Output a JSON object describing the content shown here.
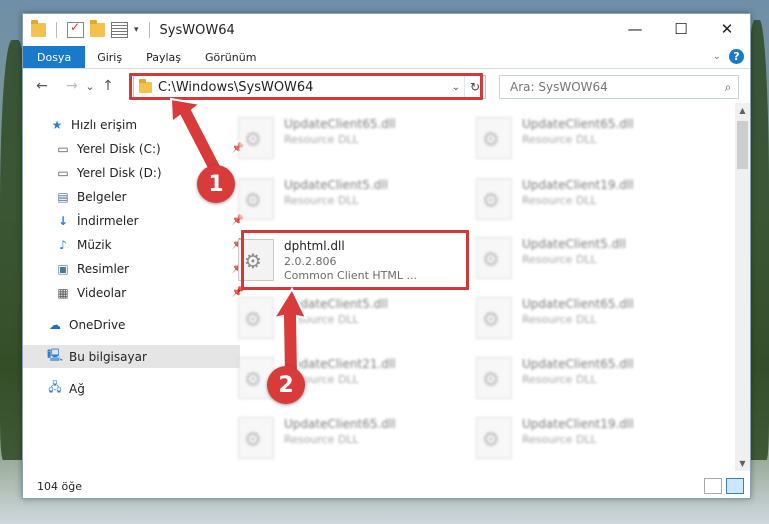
{
  "window": {
    "title": "SysWOW64",
    "buttons": {
      "minimize": "—",
      "maximize": "☐",
      "close": "✕"
    }
  },
  "ribbon": {
    "tabs": [
      "Dosya",
      "Giriş",
      "Paylaş",
      "Görünüm"
    ],
    "active": "Dosya",
    "help": "?"
  },
  "nav": {
    "back": "←",
    "forward": "→",
    "recent": "⌄",
    "up": "↑",
    "address": "C:\\Windows\\SysWOW64",
    "search_placeholder": "Ara: SysWOW64"
  },
  "sidebar": {
    "items": [
      {
        "label": "Hızlı erişim",
        "icon": "star-icon",
        "pinned": false
      },
      {
        "label": "Yerel Disk (C:)",
        "icon": "drive-icon",
        "pinned": true
      },
      {
        "label": "Yerel Disk (D:)",
        "icon": "drive-icon",
        "pinned": false
      },
      {
        "label": "Belgeler",
        "icon": "document-icon",
        "pinned": false
      },
      {
        "label": "İndirmeler",
        "icon": "download-icon",
        "pinned": true
      },
      {
        "label": "Müzik",
        "icon": "music-icon",
        "pinned": true
      },
      {
        "label": "Resimler",
        "icon": "pictures-icon",
        "pinned": true
      },
      {
        "label": "Videolar",
        "icon": "video-icon",
        "pinned": true
      },
      {
        "label": "OneDrive",
        "icon": "cloud-icon",
        "pinned": false
      },
      {
        "label": "Bu bilgisayar",
        "icon": "computer-icon",
        "pinned": false
      },
      {
        "label": "Ağ",
        "icon": "network-icon",
        "pinned": false
      }
    ],
    "selected": "Bu bilgisayar"
  },
  "files": {
    "left": [
      {
        "name": "UpdateClient65.dll",
        "type": "Resource DLL"
      },
      {
        "name": "UpdateClient5.dll",
        "type": "Resource DLL"
      },
      {
        "name": "dphtml.dll",
        "version": "2.0.2.806",
        "type": "Common Client HTML ..."
      },
      {
        "name": "UpdateClient5.dll",
        "type": "Resource DLL"
      },
      {
        "name": "UpdateClient21.dll",
        "type": "Resource DLL"
      },
      {
        "name": "UpdateClient65.dll",
        "type": "Resource DLL"
      }
    ],
    "right": [
      {
        "name": "UpdateClient65.dll",
        "type": "Resource DLL"
      },
      {
        "name": "UpdateClient19.dll",
        "type": "Resource DLL"
      },
      {
        "name": "UpdateClient5.dll",
        "type": "Resource DLL"
      },
      {
        "name": "UpdateClient65.dll",
        "type": "Resource DLL"
      },
      {
        "name": "UpdateClient65.dll",
        "type": "Resource DLL"
      },
      {
        "name": "UpdateClient19.dll",
        "type": "Resource DLL"
      }
    ]
  },
  "status": {
    "count": "104 öğe"
  },
  "annotations": {
    "step1": "1",
    "step2": "2"
  },
  "colors": {
    "accent": "#1979ca",
    "highlight": "#d23a3a"
  }
}
